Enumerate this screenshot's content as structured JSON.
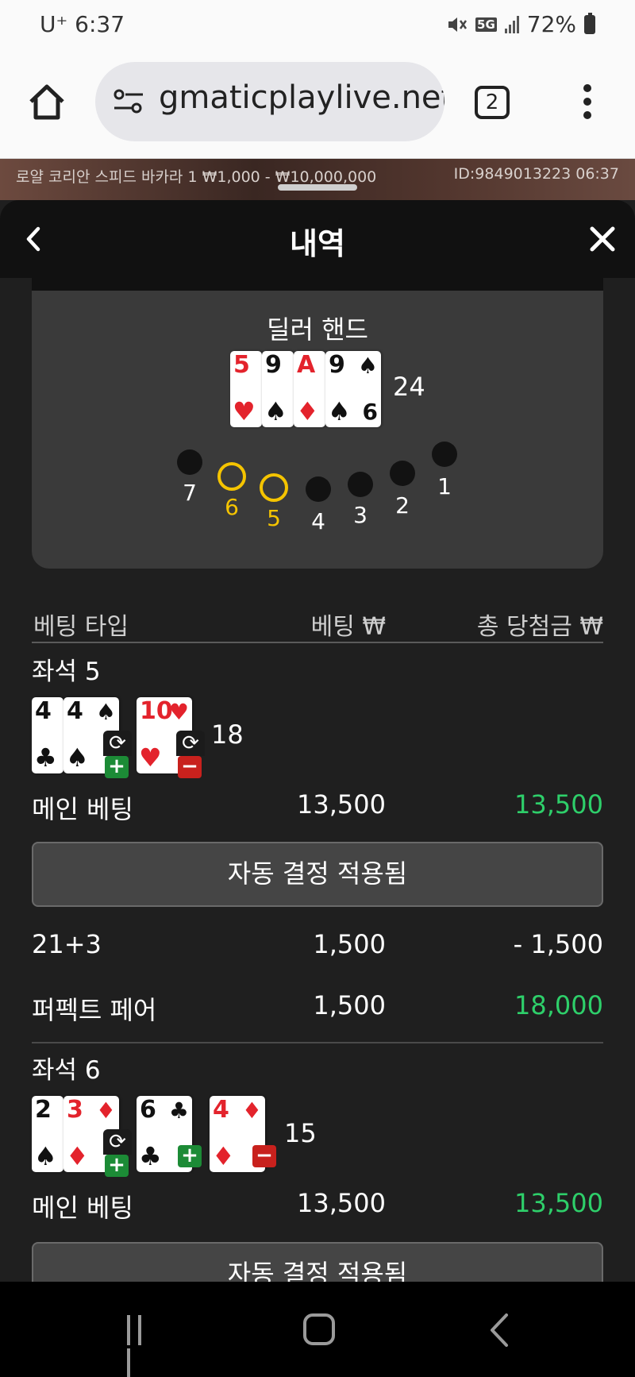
{
  "status_bar": {
    "carrier": "U⁺ 6:37",
    "network": "5G",
    "battery": "72%"
  },
  "browser": {
    "url": "gmaticplaylive.net",
    "tab_count": "2"
  },
  "game": {
    "info": "로얄 코리안 스피드 바카라 1  ₩1,000 - ₩10,000,000",
    "id_time": "ID:9849013223  06:37"
  },
  "sheet": {
    "title": "내역"
  },
  "dealer": {
    "label": "딜러 핸드",
    "score": "24",
    "cards": [
      {
        "rank": "5",
        "suit": "♥",
        "color": "red"
      },
      {
        "rank": "9",
        "suit": "♠",
        "color": "black"
      },
      {
        "rank": "A",
        "suit": "♦",
        "color": "red"
      },
      {
        "rank": "9",
        "suit": "♠",
        "color": "black",
        "bottom_rank": "6"
      }
    ]
  },
  "seats_map": {
    "labels": [
      "7",
      "6",
      "5",
      "4",
      "3",
      "2",
      "1"
    ],
    "active": [
      "6",
      "5"
    ],
    "active_color": "#f5c400"
  },
  "table": {
    "col_type": "베팅 타입",
    "col_bet": "베팅 ₩",
    "col_win": "총 당첨금 ₩"
  },
  "seat5": {
    "title": "좌석 5",
    "score": "18",
    "cards": [
      {
        "rank": "4",
        "suit": "♣",
        "color": "black"
      },
      {
        "rank": "4",
        "suit": "♠",
        "color": "black"
      },
      {
        "rank": "10",
        "suit": "♥",
        "color": "red"
      }
    ],
    "rows": [
      {
        "type": "메인 베팅",
        "bet": "13,500",
        "win": "13,500",
        "win_kind": "pos"
      },
      {
        "type": "21+3",
        "bet": "1,500",
        "win": "- 1,500",
        "win_kind": "neg"
      },
      {
        "type": "퍼펙트 페어",
        "bet": "1,500",
        "win": "18,000",
        "win_kind": "pos"
      }
    ],
    "auto_label": "자동 결정 적용됨"
  },
  "seat6": {
    "title": "좌석 6",
    "score": "15",
    "cards": [
      {
        "rank": "2",
        "suit": "♠",
        "color": "black"
      },
      {
        "rank": "3",
        "suit": "♦",
        "color": "red"
      },
      {
        "rank": "6",
        "suit": "♣",
        "color": "black"
      },
      {
        "rank": "4",
        "suit": "♦",
        "color": "red"
      }
    ],
    "rows": [
      {
        "type": "메인 베팅",
        "bet": "13,500",
        "win": "13,500",
        "win_kind": "pos"
      }
    ],
    "auto_label": "자동 결정 적용됨"
  },
  "colors": {
    "win_positive": "#2ecf6a",
    "swap_plus": "#1c8b36",
    "swap_minus": "#c8211d"
  },
  "icons": {
    "swap": "⟳",
    "plus": "+",
    "minus": "−"
  }
}
